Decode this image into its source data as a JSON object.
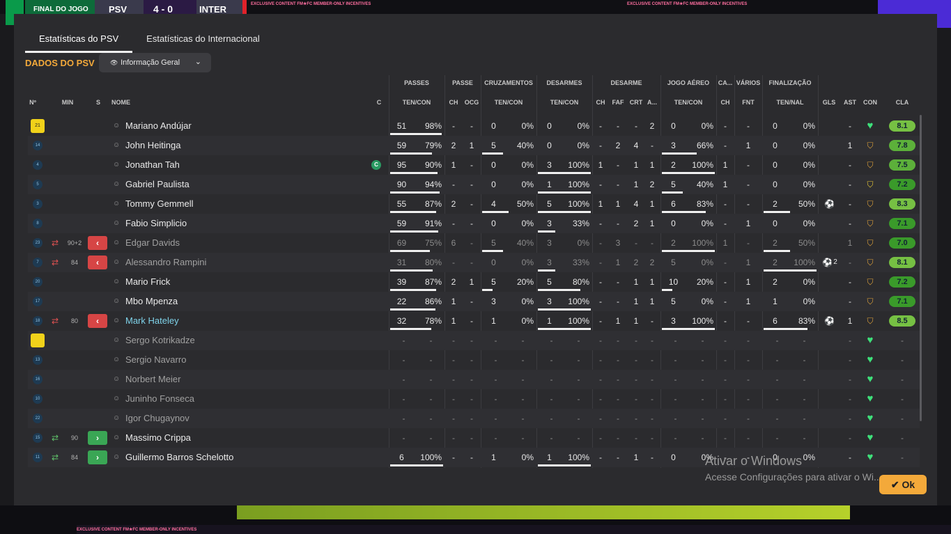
{
  "scoreboard": {
    "status": "FINAL DO JOGO",
    "home": "PSV",
    "score": "4 - 0",
    "away": "INTER",
    "ad_text": "EXCLUSIVE CONTENT  FM★FC  MEMBER-ONLY INCENTIVES"
  },
  "tabs": [
    {
      "label": "Estatísticas do PSV",
      "active": true
    },
    {
      "label": "Estatísticas do Internacional",
      "active": false
    }
  ],
  "section_title": "DADOS DO PSV",
  "dropdown": {
    "icon": "eye-icon",
    "label": "Informação Geral"
  },
  "group_headers": {
    "passes": "PASSES",
    "passe": "PASSE",
    "cruzamentos": "CRUZAMENTOS",
    "desarmes": "DESARMES",
    "desarme": "DESARME",
    "jogo_aereo": "JOGO AÉREO",
    "ca": "CA...",
    "varios": "VÁRIOS",
    "finalizacao": "FINALIZAÇÃO"
  },
  "col_headers": {
    "no": "Nº",
    "min": "MIN",
    "s": "S",
    "nome": "NOME",
    "c": "C",
    "passes": "TEN/CON",
    "passe_ch": "CH",
    "passe_ocg": "OCG",
    "cruz": "TEN/CON",
    "desarmes": "TEN/CON",
    "des_ch": "CH",
    "des_faf": "FAF",
    "des_crt": "CRT",
    "des_a": "A...",
    "aereo": "TEN/CON",
    "ca_ch": "CH",
    "fnt": "FNT",
    "fin": "TEN/NAL",
    "gls": "GLS",
    "ast": "AST",
    "con": "CON",
    "cla": "CLA"
  },
  "players": [
    {
      "num": "21",
      "gk": true,
      "min": "",
      "sub": "",
      "name": "Mariano Andújar",
      "captain": false,
      "dim": false,
      "sel": false,
      "passes": [
        "51",
        "98%"
      ],
      "passes_bar": 0.98,
      "ch": "-",
      "ocg": "-",
      "cruz": [
        "0",
        "0%"
      ],
      "cruz_bar": 0,
      "desarmes": [
        "0",
        "0%"
      ],
      "des_bar": 0,
      "dch": "-",
      "faf": "-",
      "crt": "-",
      "da": "2",
      "aereo": [
        "0",
        "0%"
      ],
      "aereo_bar": 0,
      "cach": "-",
      "fnt": "-",
      "fin": [
        "0",
        "0%"
      ],
      "fin_bar": 0,
      "gls": "",
      "ast": "-",
      "con": "heart",
      "cla": "8.1"
    },
    {
      "num": "14",
      "gk": false,
      "min": "",
      "sub": "",
      "name": "John Heitinga",
      "captain": false,
      "dim": false,
      "sel": false,
      "passes": [
        "59",
        "79%"
      ],
      "passes_bar": 0.79,
      "ch": "2",
      "ocg": "1",
      "cruz": [
        "5",
        "40%"
      ],
      "cruz_bar": 0.4,
      "desarmes": [
        "0",
        "0%"
      ],
      "des_bar": 0,
      "dch": "-",
      "faf": "2",
      "crt": "4",
      "da": "-",
      "aereo": [
        "3",
        "66%"
      ],
      "aereo_bar": 0.66,
      "cach": "-",
      "fnt": "1",
      "fin": [
        "0",
        "0%"
      ],
      "fin_bar": 0,
      "gls": "",
      "ast": "1",
      "con": "badge",
      "cla": "7.8"
    },
    {
      "num": "4",
      "gk": false,
      "min": "",
      "sub": "",
      "name": "Jonathan Tah",
      "captain": true,
      "dim": false,
      "sel": false,
      "passes": [
        "95",
        "90%"
      ],
      "passes_bar": 0.9,
      "ch": "1",
      "ocg": "-",
      "cruz": [
        "0",
        "0%"
      ],
      "cruz_bar": 0,
      "desarmes": [
        "3",
        "100%"
      ],
      "des_bar": 1,
      "dch": "1",
      "faf": "-",
      "crt": "1",
      "da": "1",
      "aereo": [
        "2",
        "100%"
      ],
      "aereo_bar": 1,
      "cach": "1",
      "fnt": "-",
      "fin": [
        "0",
        "0%"
      ],
      "fin_bar": 0,
      "gls": "",
      "ast": "-",
      "con": "badge",
      "cla": "7.5"
    },
    {
      "num": "5",
      "gk": false,
      "min": "",
      "sub": "",
      "name": "Gabriel Paulista",
      "captain": false,
      "dim": false,
      "sel": false,
      "passes": [
        "90",
        "94%"
      ],
      "passes_bar": 0.94,
      "ch": "-",
      "ocg": "-",
      "cruz": [
        "0",
        "0%"
      ],
      "cruz_bar": 0,
      "desarmes": [
        "1",
        "100%"
      ],
      "des_bar": 1,
      "dch": "-",
      "faf": "-",
      "crt": "1",
      "da": "2",
      "aereo": [
        "5",
        "40%"
      ],
      "aereo_bar": 0.4,
      "cach": "1",
      "fnt": "-",
      "fin": [
        "0",
        "0%"
      ],
      "fin_bar": 0,
      "gls": "",
      "ast": "-",
      "con": "badge-y",
      "cla": "7.2"
    },
    {
      "num": "3",
      "gk": false,
      "min": "",
      "sub": "",
      "name": "Tommy Gemmell",
      "captain": false,
      "dim": false,
      "sel": false,
      "passes": [
        "55",
        "87%"
      ],
      "passes_bar": 0.87,
      "ch": "2",
      "ocg": "-",
      "cruz": [
        "4",
        "50%"
      ],
      "cruz_bar": 0.5,
      "desarmes": [
        "5",
        "100%"
      ],
      "des_bar": 1,
      "dch": "1",
      "faf": "1",
      "crt": "4",
      "da": "1",
      "aereo": [
        "6",
        "83%"
      ],
      "aereo_bar": 0.83,
      "cach": "-",
      "fnt": "-",
      "fin": [
        "2",
        "50%"
      ],
      "fin_bar": 0.5,
      "gls": "ball",
      "ast": "-",
      "con": "badge",
      "cla": "8.3"
    },
    {
      "num": "8",
      "gk": false,
      "min": "",
      "sub": "",
      "name": "Fabio Simplicio",
      "captain": false,
      "dim": false,
      "sel": false,
      "passes": [
        "59",
        "91%"
      ],
      "passes_bar": 0.91,
      "ch": "-",
      "ocg": "-",
      "cruz": [
        "0",
        "0%"
      ],
      "cruz_bar": 0,
      "desarmes": [
        "3",
        "33%"
      ],
      "des_bar": 0.33,
      "dch": "-",
      "faf": "-",
      "crt": "2",
      "da": "1",
      "aereo": [
        "0",
        "0%"
      ],
      "aereo_bar": 0,
      "cach": "-",
      "fnt": "1",
      "fin": [
        "0",
        "0%"
      ],
      "fin_bar": 0,
      "gls": "",
      "ast": "-",
      "con": "badge",
      "cla": "7.1"
    },
    {
      "num": "23",
      "gk": false,
      "min": "90+2",
      "sub": "out",
      "name": "Edgar Davids",
      "captain": false,
      "dim": true,
      "sel": false,
      "passes": [
        "69",
        "75%"
      ],
      "passes_bar": 0.75,
      "ch": "6",
      "ocg": "-",
      "cruz": [
        "5",
        "40%"
      ],
      "cruz_bar": 0.4,
      "desarmes": [
        "3",
        "0%"
      ],
      "des_bar": 0,
      "dch": "-",
      "faf": "3",
      "crt": "-",
      "da": "-",
      "aereo": [
        "2",
        "100%"
      ],
      "aereo_bar": 1,
      "cach": "1",
      "fnt": "-",
      "fin": [
        "2",
        "50%"
      ],
      "fin_bar": 0.5,
      "gls": "",
      "ast": "1",
      "con": "badge",
      "cla": "7.0"
    },
    {
      "num": "7",
      "gk": false,
      "min": "84",
      "sub": "out",
      "name": "Alessandro Rampini",
      "captain": false,
      "dim": true,
      "sel": false,
      "passes": [
        "31",
        "80%"
      ],
      "passes_bar": 0.8,
      "ch": "-",
      "ocg": "-",
      "cruz": [
        "0",
        "0%"
      ],
      "cruz_bar": 0,
      "desarmes": [
        "3",
        "33%"
      ],
      "des_bar": 0.33,
      "dch": "-",
      "faf": "1",
      "crt": "2",
      "da": "2",
      "aereo": [
        "5",
        "0%"
      ],
      "aereo_bar": 0,
      "cach": "-",
      "fnt": "1",
      "fin": [
        "2",
        "100%"
      ],
      "fin_bar": 1,
      "gls": "ball2",
      "ast": "-",
      "con": "badge",
      "cla": "8.1"
    },
    {
      "num": "20",
      "gk": false,
      "min": "",
      "sub": "",
      "name": "Mario Frick",
      "captain": false,
      "dim": false,
      "sel": false,
      "passes": [
        "39",
        "87%"
      ],
      "passes_bar": 0.87,
      "ch": "2",
      "ocg": "1",
      "cruz": [
        "5",
        "20%"
      ],
      "cruz_bar": 0.2,
      "desarmes": [
        "5",
        "80%"
      ],
      "des_bar": 0.8,
      "dch": "-",
      "faf": "-",
      "crt": "1",
      "da": "1",
      "aereo": [
        "10",
        "20%"
      ],
      "aereo_bar": 0.2,
      "cach": "-",
      "fnt": "1",
      "fin": [
        "2",
        "0%"
      ],
      "fin_bar": 0,
      "gls": "",
      "ast": "-",
      "con": "badge",
      "cla": "7.2"
    },
    {
      "num": "17",
      "gk": false,
      "min": "",
      "sub": "",
      "name": "Mbo Mpenza",
      "captain": false,
      "dim": false,
      "sel": false,
      "passes": [
        "22",
        "86%"
      ],
      "passes_bar": 0.86,
      "ch": "1",
      "ocg": "-",
      "cruz": [
        "3",
        "0%"
      ],
      "cruz_bar": 0,
      "desarmes": [
        "3",
        "100%"
      ],
      "des_bar": 1,
      "dch": "-",
      "faf": "-",
      "crt": "1",
      "da": "1",
      "aereo": [
        "5",
        "0%"
      ],
      "aereo_bar": 0,
      "cach": "-",
      "fnt": "1",
      "fin": [
        "1",
        "0%"
      ],
      "fin_bar": 0,
      "gls": "",
      "ast": "-",
      "con": "badge",
      "cla": "7.1"
    },
    {
      "num": "18",
      "gk": false,
      "min": "80",
      "sub": "out",
      "name": "Mark Hateley",
      "captain": false,
      "dim": false,
      "sel": true,
      "passes": [
        "32",
        "78%"
      ],
      "passes_bar": 0.78,
      "ch": "1",
      "ocg": "-",
      "cruz": [
        "1",
        "0%"
      ],
      "cruz_bar": 0,
      "desarmes": [
        "1",
        "100%"
      ],
      "des_bar": 1,
      "dch": "-",
      "faf": "1",
      "crt": "1",
      "da": "-",
      "aereo": [
        "3",
        "100%"
      ],
      "aereo_bar": 1,
      "cach": "-",
      "fnt": "-",
      "fin": [
        "6",
        "83%"
      ],
      "fin_bar": 0.83,
      "gls": "ball",
      "ast": "1",
      "con": "badge",
      "cla": "8.5"
    },
    {
      "num": "",
      "gk": true,
      "min": "",
      "sub": "",
      "name": "Sergo Kotrikadze",
      "captain": false,
      "dim": true,
      "sel": false,
      "empty": true,
      "con": "heart",
      "cla": "-"
    },
    {
      "num": "13",
      "gk": false,
      "min": "",
      "sub": "",
      "name": "Sergio Navarro",
      "captain": false,
      "dim": true,
      "sel": false,
      "empty": true,
      "con": "heart",
      "cla": "-"
    },
    {
      "num": "16",
      "gk": false,
      "min": "",
      "sub": "",
      "name": "Norbert Meier",
      "captain": false,
      "dim": true,
      "sel": false,
      "empty": true,
      "con": "heart",
      "cla": "-"
    },
    {
      "num": "10",
      "gk": false,
      "min": "",
      "sub": "",
      "name": "Juninho Fonseca",
      "captain": false,
      "dim": true,
      "sel": false,
      "empty": true,
      "con": "heart",
      "cla": "-"
    },
    {
      "num": "22",
      "gk": false,
      "min": "",
      "sub": "",
      "name": "Igor Chugaynov",
      "captain": false,
      "dim": true,
      "sel": false,
      "empty": true,
      "con": "heart",
      "cla": "-"
    },
    {
      "num": "15",
      "gk": false,
      "min": "90",
      "sub": "in",
      "name": "Massimo Crippa",
      "captain": false,
      "dim": false,
      "sel": false,
      "empty": true,
      "con": "heart",
      "cla": "-"
    },
    {
      "num": "11",
      "gk": false,
      "min": "84",
      "sub": "in",
      "name": "Guillermo Barros Schelotto",
      "captain": false,
      "dim": false,
      "sel": false,
      "passes": [
        "6",
        "100%"
      ],
      "passes_bar": 1,
      "ch": "-",
      "ocg": "-",
      "cruz": [
        "1",
        "0%"
      ],
      "cruz_bar": 0,
      "desarmes": [
        "1",
        "100%"
      ],
      "des_bar": 1,
      "dch": "-",
      "faf": "-",
      "crt": "1",
      "da": "-",
      "aereo": [
        "0",
        "0%"
      ],
      "aereo_bar": 0,
      "cach": "-",
      "fnt": "-",
      "fin": [
        "0",
        "0%"
      ],
      "fin_bar": 0,
      "gls": "",
      "ast": "-",
      "con": "heart",
      "cla": "-"
    }
  ],
  "watermark": {
    "title": "Ativar o Windows",
    "subtitle": "Acesse Configurações para ativar o Wi..."
  },
  "ok_label": "Ok"
}
